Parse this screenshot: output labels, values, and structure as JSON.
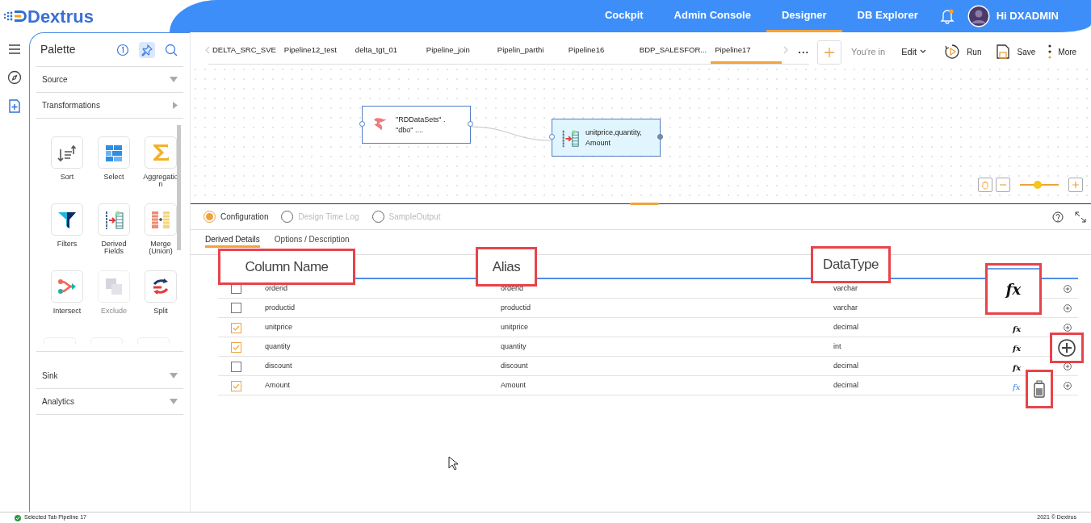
{
  "header": {
    "logo_text": "Dextrus",
    "nav": [
      {
        "label": "Cockpit",
        "selected": false
      },
      {
        "label": "Admin Console",
        "selected": false
      },
      {
        "label": "Designer",
        "selected": true
      },
      {
        "label": "DB Explorer",
        "selected": false
      }
    ],
    "notification_dot": true,
    "greeting": "Hi DXADMIN"
  },
  "rail": [
    {
      "kind": "menu",
      "selected": false
    },
    {
      "kind": "compass",
      "selected": false
    },
    {
      "kind": "new-document",
      "selected": true
    }
  ],
  "palette": {
    "title": "Palette",
    "tools": [
      {
        "kind": "info",
        "selected": false
      },
      {
        "kind": "pin",
        "selected": true
      },
      {
        "kind": "search",
        "selected": false
      }
    ],
    "sections_top": [
      {
        "label": "Source",
        "expanded": false
      },
      {
        "label": "Transformations",
        "expanded": true
      }
    ],
    "items": [
      {
        "label": "Sort",
        "kind": "sort",
        "disabled": false
      },
      {
        "label": "Select",
        "kind": "select",
        "disabled": false
      },
      {
        "label": "Aggregation",
        "kind": "aggregation",
        "disabled": false
      },
      {
        "label": "Filters",
        "kind": "filter",
        "disabled": false
      },
      {
        "label": "Derived Fields",
        "kind": "derived",
        "disabled": false
      },
      {
        "label": "Merge (Union)",
        "kind": "merge",
        "disabled": false
      },
      {
        "label": "Intersect",
        "kind": "intersect",
        "disabled": false
      },
      {
        "label": "Exclude",
        "kind": "exclude",
        "disabled": true
      },
      {
        "label": "Split",
        "kind": "split",
        "disabled": false
      }
    ],
    "sections_bottom": [
      {
        "label": "Sink",
        "expanded": false
      },
      {
        "label": "Analytics",
        "expanded": false
      }
    ]
  },
  "pipeline_tabs": [
    {
      "label": "DELTA_SRC_SVE",
      "selected": false
    },
    {
      "label": "Pipeline12_test",
      "selected": false
    },
    {
      "label": "delta_tgt_01",
      "selected": false
    },
    {
      "label": "Pipeline_join",
      "selected": false
    },
    {
      "label": "Pipelin_parthi",
      "selected": false
    },
    {
      "label": "Pipeline16",
      "selected": false
    },
    {
      "label": "BDP_SALESFOR...",
      "selected": false
    },
    {
      "label": "Pipeline17",
      "selected": true
    }
  ],
  "more_tabs": "...",
  "mode_label": "You're in",
  "mode": "Edit",
  "actions": [
    {
      "kind": "run",
      "label": "Run"
    },
    {
      "kind": "save",
      "label": "Save"
    },
    {
      "kind": "more",
      "label": "More"
    }
  ],
  "canvas": {
    "nodes": [
      {
        "kind": "source",
        "text": "\"RDDataSets\" .\n\"dbo\" ....",
        "selected": false
      },
      {
        "kind": "derived",
        "text": "unitprice,quantity,\nAmount",
        "selected": true
      }
    ],
    "zoom": {
      "level": 0.45
    }
  },
  "panel": {
    "views": [
      {
        "label": "Configuration",
        "selected": true,
        "disabled": false
      },
      {
        "label": "Design Time Log",
        "selected": false,
        "disabled": true
      },
      {
        "label": "SampleOutput",
        "selected": false,
        "disabled": true
      }
    ],
    "subtabs": [
      {
        "label": "Derived Details",
        "selected": true
      },
      {
        "label": "Options / Description",
        "selected": false
      }
    ],
    "rows": [
      {
        "checked": false,
        "column_name": "orderid",
        "alias": "orderid",
        "datatype": "varchar",
        "function": null
      },
      {
        "checked": false,
        "column_name": "productid",
        "alias": "productid",
        "datatype": "varchar",
        "function": null
      },
      {
        "checked": true,
        "column_name": "unitprice",
        "alias": "unitprice",
        "datatype": "decimal",
        "function": "fx",
        "expression_set": false
      },
      {
        "checked": true,
        "column_name": "quantity",
        "alias": "quantity",
        "datatype": "int",
        "function": "fx",
        "expression_set": false
      },
      {
        "checked": false,
        "column_name": "discount",
        "alias": "discount",
        "datatype": "decimal",
        "function": "fx",
        "expression_set": false
      },
      {
        "checked": true,
        "column_name": "Amount",
        "alias": "Amount",
        "datatype": "decimal",
        "function": "fx",
        "expression_set": true
      }
    ]
  },
  "callouts": [
    {
      "kind": "label",
      "text": "Column Name"
    },
    {
      "kind": "label",
      "text": "Alias"
    },
    {
      "kind": "label",
      "text": "DataType"
    },
    {
      "kind": "fx",
      "text": "fx"
    },
    {
      "kind": "add"
    },
    {
      "kind": "delete"
    }
  ],
  "status_bar": {
    "message": "Selected Tab Pipeline 17",
    "copyright": "2021 © Dextrus"
  }
}
